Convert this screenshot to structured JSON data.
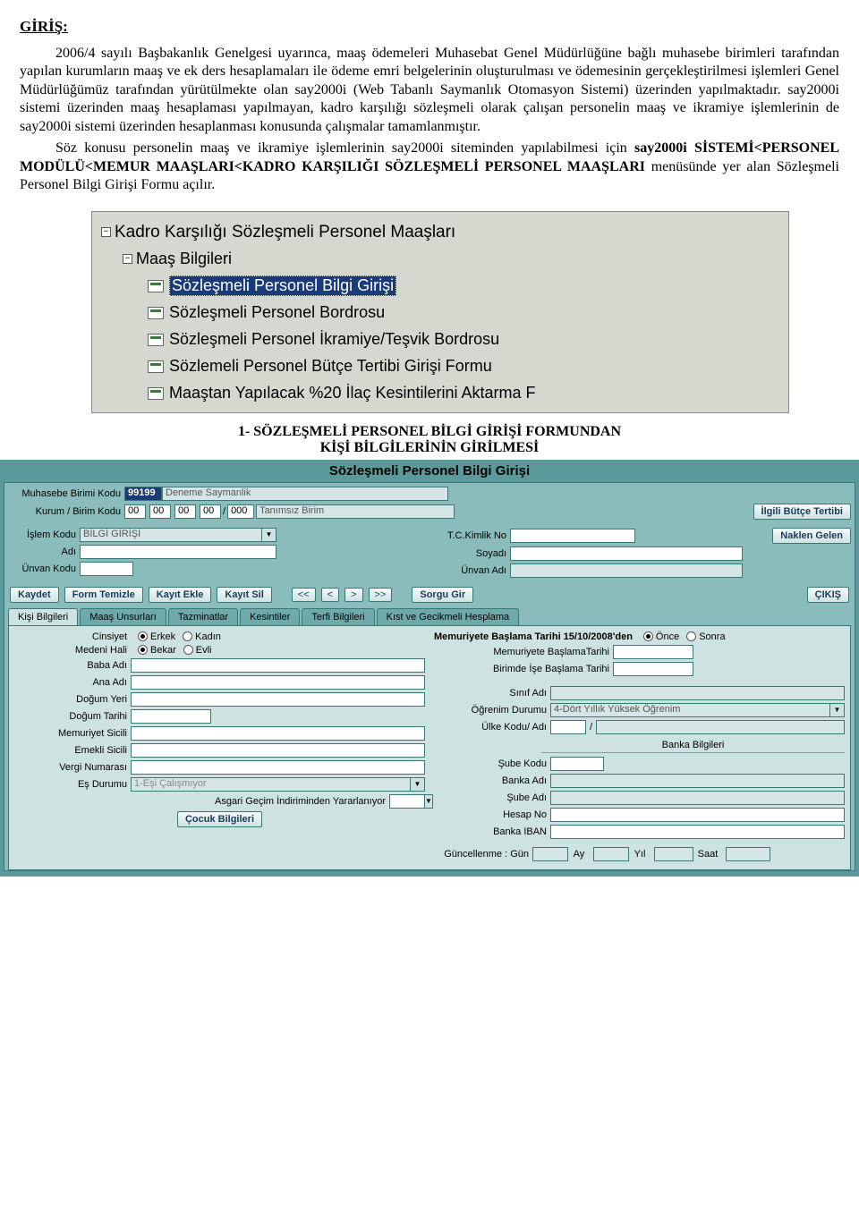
{
  "doc": {
    "heading": "GİRİŞ:",
    "p1": "2006/4 sayılı Başbakanlık Genelgesi uyarınca, maaş ödemeleri Muhasebat Genel Müdürlüğüne bağlı muhasebe birimleri tarafından yapılan kurumların maaş ve ek ders hesaplamaları ile ödeme emri belgelerinin oluşturulması ve ödemesinin gerçekleştirilmesi işlemleri Genel Müdürlüğümüz tarafından yürütülmekte olan say2000i (Web Tabanlı Saymanlık Otomasyon Sistemi) üzerinden yapılmaktadır. say2000i sistemi üzerinden maaş hesaplaması yapılmayan, kadro karşılığı sözleşmeli olarak çalışan personelin maaş ve ikramiye işlemlerinin de say2000i sistemi üzerinden hesaplanması konusunda çalışmalar tamamlanmıştır.",
    "p2_a": "Söz konusu personelin maaş ve ikramiye işlemlerinin say2000i siteminden yapılabilmesi için ",
    "p2_b": "say2000i SİSTEMİ<PERSONEL MODÜLÜ<MEMUR MAAŞLARI<KADRO KARŞILIĞI SÖZLEŞMELİ PERSONEL MAAŞLARI",
    "p2_c": " menüsünde yer alan Sözleşmeli Personel Bilgi Girişi Formu açılır.",
    "section1_a": "1-  SÖZLEŞMELİ PERSONEL BİLGİ GİRİŞİ FORMUNDAN",
    "section1_b": "KİŞİ BİLGİLERİNİN GİRİLMESİ"
  },
  "tree": {
    "root": "Kadro Karşılığı Sözleşmeli Personel Maaşları",
    "group": "Maaş Bilgileri",
    "items": [
      "Sözleşmeli Personel Bilgi Girişi",
      "Sözleşmeli Personel Bordrosu",
      "Sözleşmeli Personel İkramiye/Teşvik Bordrosu",
      "Sözlemeli Personel Bütçe Tertibi Girişi Formu",
      "Maaştan Yapılacak %20 İlaç Kesintilerini Aktarma F"
    ]
  },
  "form": {
    "title": "Sözleşmeli Personel Bilgi Girişi",
    "labels": {
      "muhasebe": "Muhasebe Birimi Kodu",
      "kurum": "Kurum / Birim Kodu",
      "islem": "İşlem Kodu",
      "adi": "Adı",
      "unvan": "Ünvan Kodu",
      "tc": "T.C.Kimlik No",
      "soyadi": "Soyadı",
      "unvanadi": "Ünvan Adı"
    },
    "values": {
      "muhasebe_kod": "99199",
      "muhasebe_ad": "Deneme Saymanlik",
      "kurum1": "00",
      "kurum2": "00",
      "kurum3": "00",
      "kurum4": "00",
      "kurum5": "000",
      "kurum_ad": "Tanımsız Birim",
      "islem_kodu": "BİLGİ GİRİŞİ"
    },
    "buttons": {
      "ilgili": "İlgili Bütçe Tertibi",
      "naklen": "Naklen Gelen",
      "kaydet": "Kaydet",
      "temizle": "Form Temizle",
      "ekle": "Kayıt Ekle",
      "sil": "Kayıt Sil",
      "first": "<<",
      "prev": "<",
      "next": ">",
      "last": ">>",
      "sorgu": "Sorgu Gir",
      "cikis": "ÇIKIŞ",
      "cocuk": "Çocuk Bilgileri"
    },
    "tabs": [
      "Kişi Bilgileri",
      "Maaş Unsurları",
      "Tazminatlar",
      "Kesintiler",
      "Terfi Bilgileri",
      "Kıst ve Gecikmeli Hesplama"
    ],
    "pane": {
      "left": {
        "cinsiyet": "Cinsiyet",
        "erkek": "Erkek",
        "kadin": "Kadın",
        "medeni": "Medeni Hali",
        "bekar": "Bekar",
        "evli": "Evli",
        "baba": "Baba Adı",
        "ana": "Ana Adı",
        "dogumyeri": "Doğum Yeri",
        "dogumtarihi": "Doğum Tarihi",
        "memsicil": "Memuriyet Sicili",
        "emsicil": "Emekli Sicili",
        "vergi": "Vergi Numarası",
        "esdurumu": "Eş Durumu",
        "esdurumu_val": "1-Eşi Çalışmıyor",
        "asgari": "Asgari Geçim İndiriminden Yararlanıyor"
      },
      "right": {
        "memstart": "Memuriyete Başlama Tarihi 15/10/2008'den",
        "once": "Önce",
        "sonra": "Sonra",
        "membaslama": "Memuriyete BaşlamaTarihi",
        "birimde": "Birimde İşe Başlama Tarihi",
        "sinif": "Sınıf Adı",
        "ogrenim": "Öğrenim Durumu",
        "ogrenim_val": "4-Dört Yıllık Yüksek Öğrenim",
        "ulke": "Ülke Kodu/ Adı",
        "slash": "/",
        "banka_hdr": "Banka Bilgileri",
        "sube": "Şube Kodu",
        "bankaadi": "Banka Adı",
        "subeadi": "Şube Adı",
        "hesap": "Hesap No",
        "iban": "Banka IBAN",
        "guncel": "Güncellenme : Gün",
        "ay": "Ay",
        "yil": "Yıl",
        "saat": "Saat"
      }
    }
  }
}
